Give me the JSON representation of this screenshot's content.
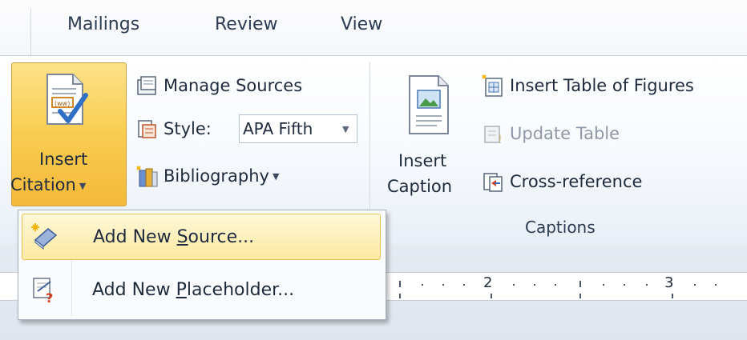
{
  "tabs": [
    "Mailings",
    "Review",
    "View"
  ],
  "citations_group": {
    "insert_citation_line1": "Insert",
    "insert_citation_line2": "Citation",
    "manage_sources": "Manage Sources",
    "style_label": "Style:",
    "style_value": "APA Fifth",
    "bibliography": "Bibliography"
  },
  "captions_group": {
    "insert_caption_line1": "Insert",
    "insert_caption_line2": "Caption",
    "insert_table_of_figures": "Insert Table of Figures",
    "update_table": "Update Table",
    "cross_reference": "Cross-reference",
    "group_label": "Captions"
  },
  "dropdown_menu": {
    "add_new_source": {
      "pre": "Add New ",
      "accel": "S",
      "post": "ource..."
    },
    "add_new_placeholder": {
      "pre": "Add New ",
      "accel": "P",
      "post": "laceholder..."
    }
  },
  "ruler": {
    "marks": [
      "2",
      "3"
    ]
  },
  "colors": {
    "highlight": "#f8cc4f",
    "menu_highlight": "#fde9a2",
    "ribbon_bg": "#f6f9fd"
  }
}
